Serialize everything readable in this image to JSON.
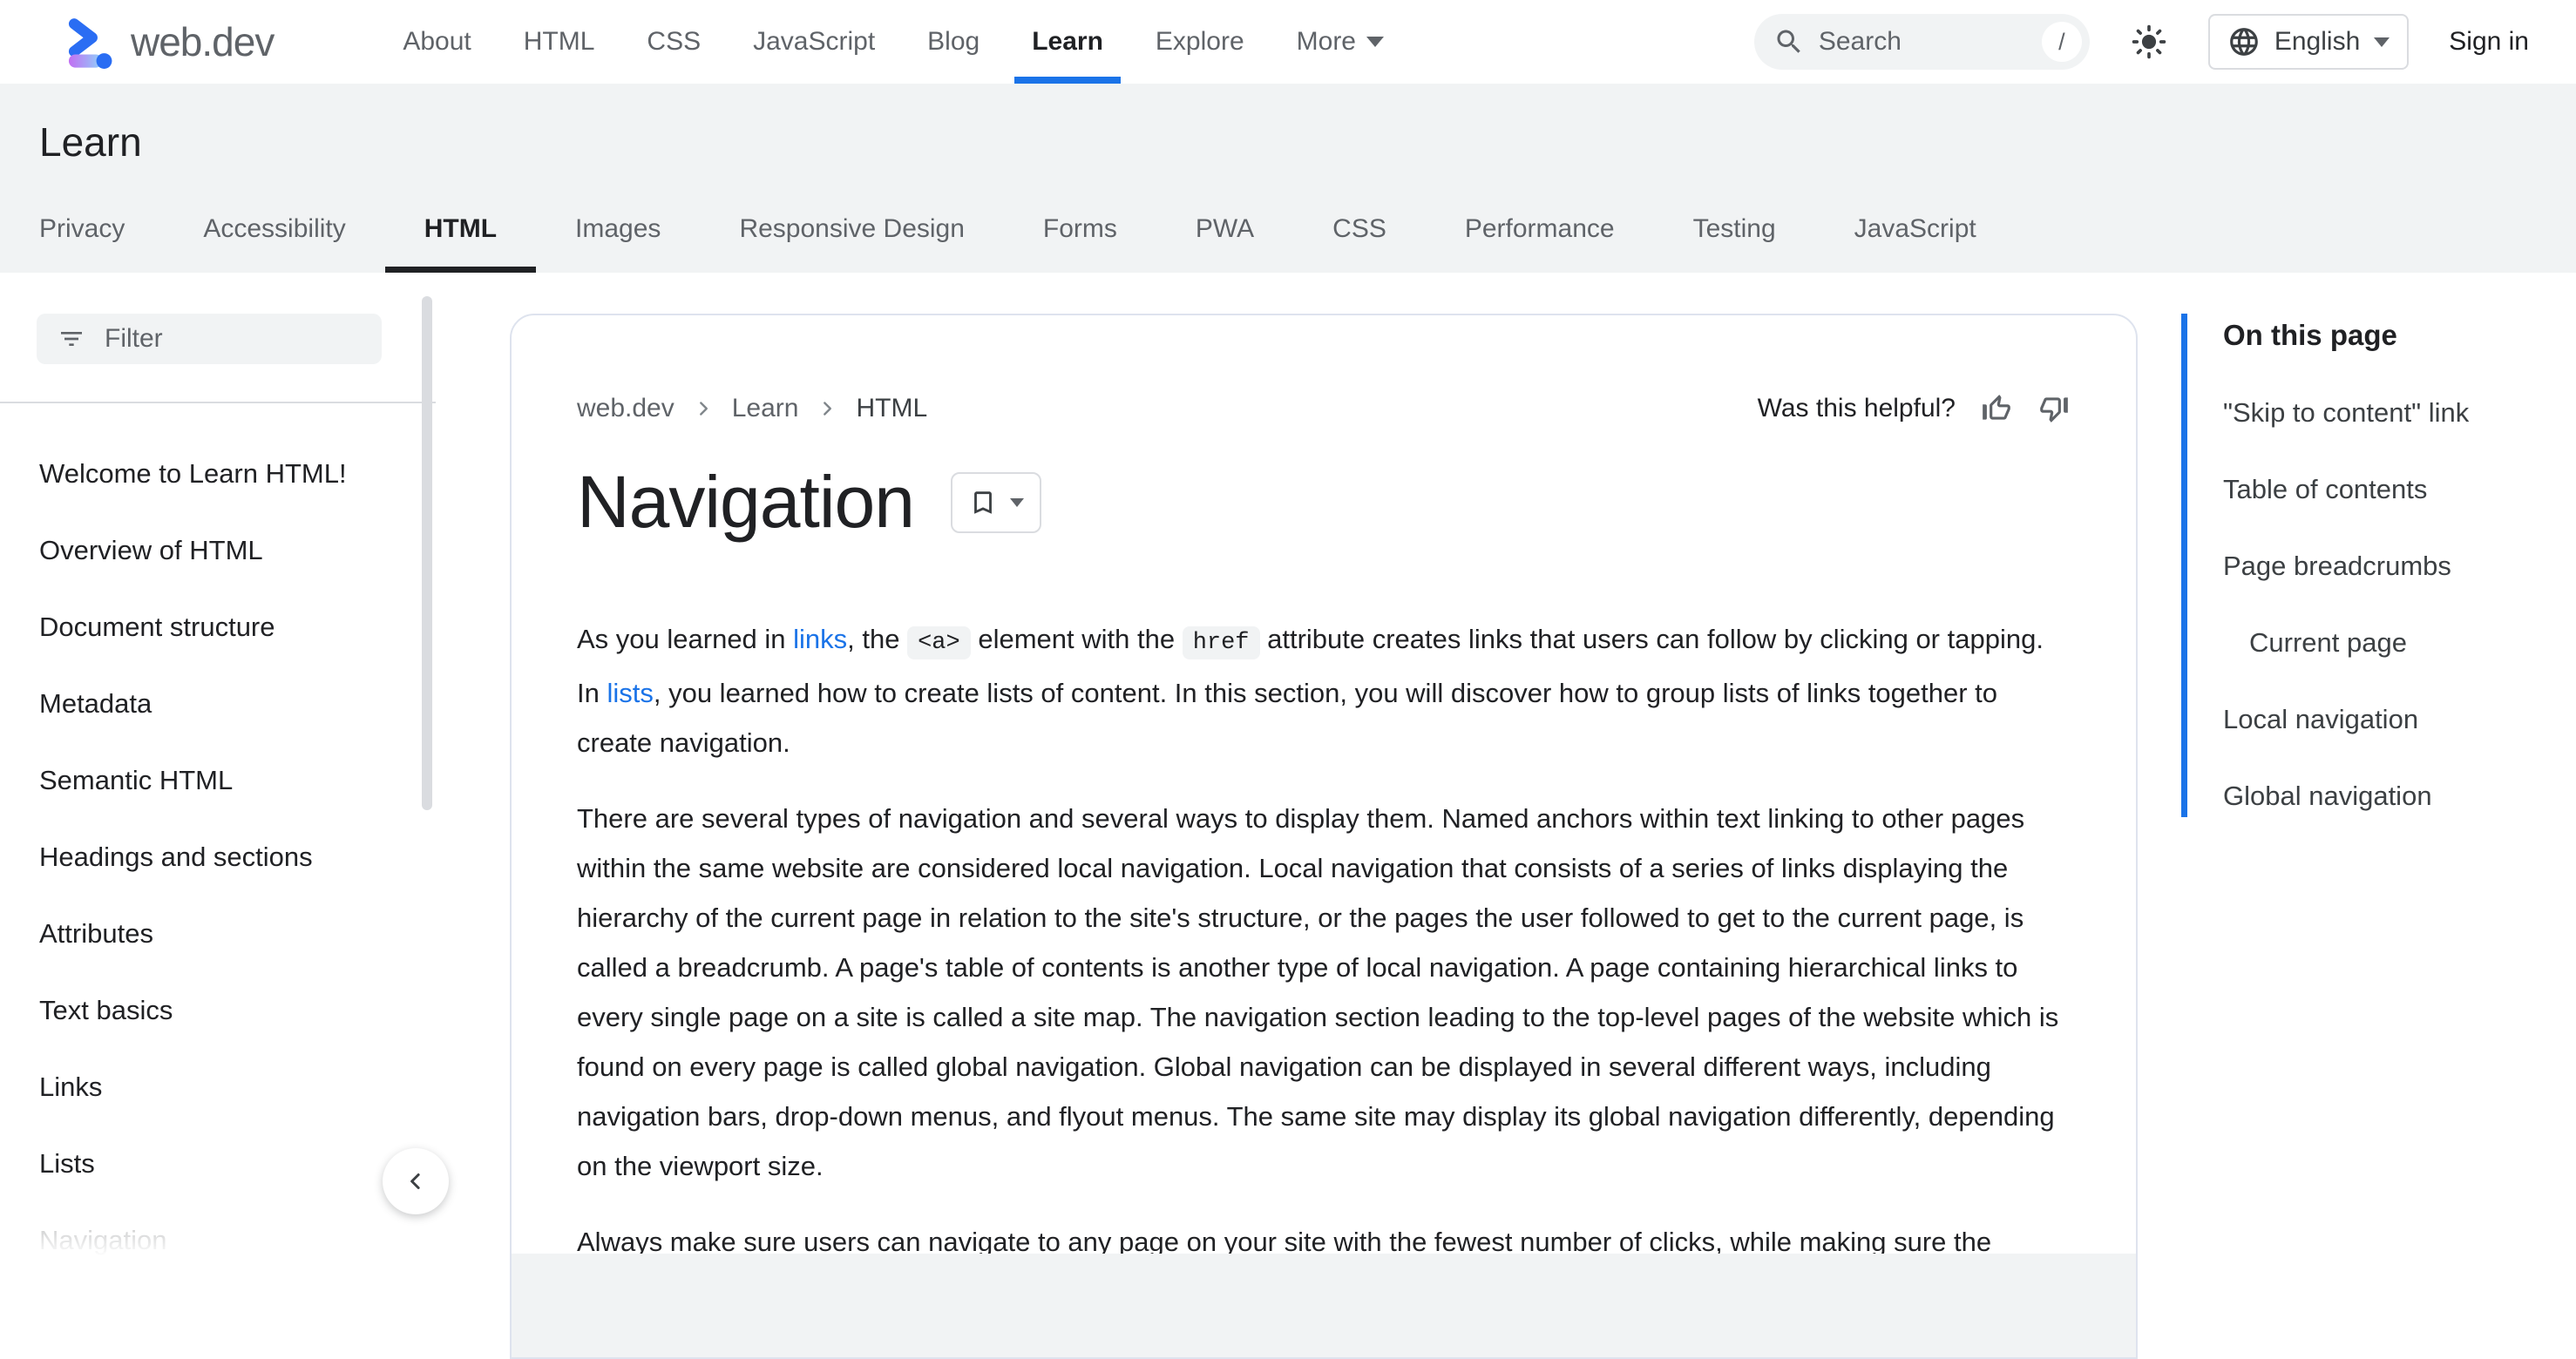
{
  "colors": {
    "accent_blue": "#1a73e8",
    "text_dark": "#202124",
    "text_gray": "#5f6368",
    "band_gray": "#f1f3f4",
    "tab_underline_dark": "#202124",
    "logo_blue": "#2a6df3",
    "logo_purple": "#c26ff2",
    "logo_light_blue": "#8fd2fa"
  },
  "header": {
    "brand": "web.dev",
    "nav": [
      {
        "label": "About"
      },
      {
        "label": "HTML"
      },
      {
        "label": "CSS"
      },
      {
        "label": "JavaScript"
      },
      {
        "label": "Blog"
      },
      {
        "label": "Learn"
      },
      {
        "label": "Explore"
      },
      {
        "label": "More"
      }
    ],
    "active_nav": "Learn",
    "search_placeholder": "Search",
    "search_shortcut": "/",
    "language": "English",
    "sign_in": "Sign in"
  },
  "learn_header": {
    "title": "Learn",
    "tabs": [
      {
        "label": "Privacy"
      },
      {
        "label": "Accessibility"
      },
      {
        "label": "HTML"
      },
      {
        "label": "Images"
      },
      {
        "label": "Responsive Design"
      },
      {
        "label": "Forms"
      },
      {
        "label": "PWA"
      },
      {
        "label": "CSS"
      },
      {
        "label": "Performance"
      },
      {
        "label": "Testing"
      },
      {
        "label": "JavaScript"
      }
    ],
    "active_tab": "HTML"
  },
  "sidebar": {
    "filter_placeholder": "Filter",
    "items": [
      {
        "label": "Welcome to Learn HTML!"
      },
      {
        "label": "Overview of HTML"
      },
      {
        "label": "Document structure"
      },
      {
        "label": "Metadata"
      },
      {
        "label": "Semantic HTML"
      },
      {
        "label": "Headings and sections"
      },
      {
        "label": "Attributes"
      },
      {
        "label": "Text basics"
      },
      {
        "label": "Links"
      },
      {
        "label": "Lists"
      },
      {
        "label": "Navigation"
      }
    ]
  },
  "article": {
    "breadcrumb": [
      {
        "label": "web.dev"
      },
      {
        "label": "Learn"
      },
      {
        "label": "HTML"
      }
    ],
    "feedback_label": "Was this helpful?",
    "title": "Navigation",
    "p1": {
      "t1": "As you learned in ",
      "link1": "links",
      "t2": ", the ",
      "code1": "<a>",
      "t3": " element with the ",
      "code2": "href",
      "t4": " attribute creates links that users can follow by clicking or tapping. In ",
      "link2": "lists",
      "t5": ", you learned how to create lists of content. In this section, you will discover how to group lists of links together to create navigation."
    },
    "p2": "There are several types of navigation and several ways to display them. Named anchors within text linking to other pages within the same website are considered local navigation. Local navigation that consists of a series of links displaying the hierarchy of the current page in relation to the site's structure, or the pages the user followed to get to the current page, is called a breadcrumb. A page's table of contents is another type of local navigation. A page containing hierarchical links to every single page on a site is called a site map. The navigation section leading to the top-level pages of the website which is found on every page is called global navigation. Global navigation can be displayed in several different ways, including navigation bars, drop-down menus, and flyout menus. The same site may display its global navigation differently, depending on the viewport size.",
    "p3": "Always make sure users can navigate to any page on your site with the fewest number of clicks, while making sure the"
  },
  "toc": {
    "title": "On this page",
    "items": [
      {
        "label": "\"Skip to content\" link"
      },
      {
        "label": "Table of contents"
      },
      {
        "label": "Page breadcrumbs"
      },
      {
        "label": "Current page"
      },
      {
        "label": "Local navigation"
      },
      {
        "label": "Global navigation"
      }
    ]
  }
}
